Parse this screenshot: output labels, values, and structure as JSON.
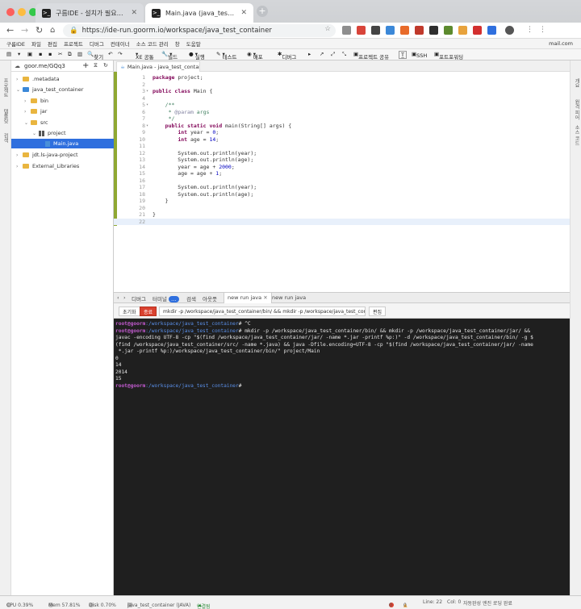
{
  "browser": {
    "tabs": [
      {
        "label": "구름IDE - 설치가 필요없는 통합개발환경",
        "active": false
      },
      {
        "label": "Main.java (java_test_container)",
        "active": true
      }
    ],
    "url": "https://ide-run.goorm.io/workspace/java_test_container",
    "account": "mail.com"
  },
  "menu": [
    "구름IDE",
    "파일",
    "편집",
    "프로젝트",
    "디버그",
    "컨테이너",
    "소스 코드 관리",
    "창",
    "도움말"
  ],
  "toolbar": {
    "find": "찾기",
    "xe": "XE 공통",
    "build": "빌드",
    "run": "실행",
    "test": "테스트",
    "deploy": "배포",
    "debug": "디버그",
    "share": "프로젝트 공유",
    "ssh": "SSH",
    "portfw": "포트포워딩"
  },
  "left_rail": [
    "프로젝트",
    "템플릿",
    "검색"
  ],
  "right_rail": [
    "개요",
    "원격 피어",
    "소스 코드"
  ],
  "explorer": {
    "title": "goor.me/GQq3",
    "items": [
      {
        "label": ".metadata",
        "depth": 1,
        "kind": "folder"
      },
      {
        "label": "java_test_container",
        "depth": 1,
        "kind": "project"
      },
      {
        "label": "bin",
        "depth": 2,
        "kind": "folder"
      },
      {
        "label": "jar",
        "depth": 2,
        "kind": "folder"
      },
      {
        "label": "src",
        "depth": 2,
        "kind": "folder"
      },
      {
        "label": "project",
        "depth": 3,
        "kind": "package"
      },
      {
        "label": "Main.java",
        "depth": 4,
        "kind": "file",
        "selected": true
      },
      {
        "label": "jdt.ls-java-project",
        "depth": 1,
        "kind": "folder"
      },
      {
        "label": "External_Libraries",
        "depth": 1,
        "kind": "folder"
      }
    ]
  },
  "editor": {
    "tab": "Main.java - java_test_contai",
    "current_line": 22,
    "lines": [
      {
        "n": "1",
        "code": "package project;"
      },
      {
        "n": "2",
        "code": ""
      },
      {
        "n": "3",
        "code": "public class Main {"
      },
      {
        "n": "4",
        "code": ""
      },
      {
        "n": "5",
        "code": "    /**"
      },
      {
        "n": "6",
        "code": "     * @param args"
      },
      {
        "n": "7",
        "code": "     */"
      },
      {
        "n": "8",
        "code": "    public static void main(String[] args) {"
      },
      {
        "n": "9",
        "code": "        int year = 0;"
      },
      {
        "n": "10",
        "code": "        int age = 14;"
      },
      {
        "n": "11",
        "code": ""
      },
      {
        "n": "12",
        "code": "        System.out.println(year);"
      },
      {
        "n": "13",
        "code": "        System.out.println(age);"
      },
      {
        "n": "14",
        "code": "        year = age + 2000;"
      },
      {
        "n": "15",
        "code": "        age = age + 1;"
      },
      {
        "n": "16",
        "code": ""
      },
      {
        "n": "17",
        "code": "        System.out.println(year);"
      },
      {
        "n": "18",
        "code": "        System.out.println(age);"
      },
      {
        "n": "19",
        "code": "    }"
      },
      {
        "n": "20",
        "code": ""
      },
      {
        "n": "21",
        "code": "}"
      },
      {
        "n": "22",
        "code": ""
      }
    ]
  },
  "bottom": {
    "tabs": [
      "디버그",
      "터미널",
      "검색",
      "아웃풋",
      "new run java",
      "new run java"
    ],
    "terminal_badge": "…",
    "run": {
      "reset": "초기화",
      "stop": "종료",
      "command": "mkdir -p /workspace/java_test_container/bin/ && mkdir -p /workspace/java_test_conta",
      "edit": "편집"
    },
    "prompt_user": "root@goorm",
    "prompt_path": ":/workspace/java_test_container",
    "prompt_end": "#",
    "terminal_lines": [
      {
        "prompt": true,
        "text": " ^C"
      },
      {
        "prompt": true,
        "text": " mkdir -p /workspace/java_test_container/bin/ && mkdir -p /workspace/java_test_container/jar/ &&"
      },
      {
        "prompt": false,
        "text": "javac -encoding UTF-8 -cp \"$(find /workspace/java_test_container/jar/ -name *.jar -printf %p:)\" -d /workspace/java_test_container/bin/ -g $"
      },
      {
        "prompt": false,
        "text": "(find /workspace/java_test_container/src/ -name *.java) && java -Dfile.encoding=UTF-8 -cp \"$(find /workspace/java_test_container/jar/ -name"
      },
      {
        "prompt": false,
        "text": " *.jar -printf %p:)/workspace/java_test_container/bin/\" project/Main"
      },
      {
        "prompt": false,
        "text": "0"
      },
      {
        "prompt": false,
        "text": "14"
      },
      {
        "prompt": false,
        "text": "2014"
      },
      {
        "prompt": false,
        "text": "15"
      },
      {
        "prompt": true,
        "text": ""
      }
    ]
  },
  "status": {
    "cpu": "CPU 0.39%",
    "mem": "Mem 57.81%",
    "disk": "Disk 0.70%",
    "container": "java_test_container (JAVA)",
    "connection": "연결됨",
    "errors": "0",
    "warnings": "0",
    "line": "Line: 22",
    "col": "Col: 0",
    "saved": "자동완성 엔진 로딩 완료"
  },
  "colors": {
    "accent": "#2f6fde",
    "stop": "#d9412f",
    "terminal_bg": "#1f1f1f",
    "prompt_user": "#c35bd0",
    "prompt_path": "#5a8fe8"
  }
}
